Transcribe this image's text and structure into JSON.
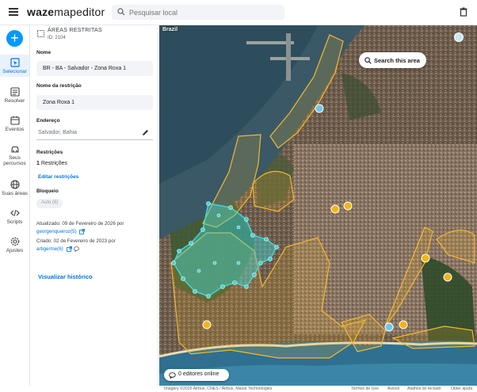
{
  "app": {
    "logo_bold": "waze",
    "logo_light": "mapeditor",
    "search_placeholder": "Pesquisar local"
  },
  "rail": {
    "items": [
      {
        "label": "Selecionar",
        "icon": "select-icon",
        "active": true
      },
      {
        "label": "Resolver",
        "icon": "resolve-icon"
      },
      {
        "label": "Eventos",
        "icon": "calendar-icon"
      },
      {
        "label": "Seus percursos",
        "icon": "car-icon"
      },
      {
        "label": "Suas áreas",
        "icon": "globe-icon"
      },
      {
        "label": "Scripts",
        "icon": "code-icon"
      },
      {
        "label": "Ajustes",
        "icon": "gear-icon"
      }
    ]
  },
  "panel": {
    "title": "ÁREAS RESTRITAS",
    "id": "ID: 2104",
    "name_label": "Nome",
    "name_value": "BR - BA - Salvador - Zona Roxa 1",
    "restriction_name_label": "Nome da restrição",
    "restriction_name_value": "Zona Roxa 1",
    "address_label": "Endereço",
    "address_value": "Salvador, Bahia",
    "restrictions_label": "Restrições",
    "restrictions_count": "1",
    "restrictions_word": "Restrições",
    "edit_restrictions": "Editar restrições",
    "lock_label": "Bloqueio",
    "lock_value": "Auto (6)",
    "updated_text": "Atualizado: 09 de Fevereiro de 2026 por",
    "updated_by": "georgenqueiroz(5)",
    "created_text": "Criado: 02 de Fevereiro de 2023 por",
    "created_by": "artigerme(6)",
    "history_link": "Visualizar histórico"
  },
  "map": {
    "country": "Brazil",
    "search_area": "Search this area",
    "editors_online": "0 editores online",
    "colors": {
      "water": "#2f6f8f",
      "area_outline": "#f5b82e",
      "selected": "#3fd6d6",
      "marker": "#f2b417"
    }
  },
  "footer": {
    "attribution": "Imagery ©2026 Airbus, CNES / Airbus, Maxar Technologies",
    "terms": "Termos de Uso",
    "notices": "Avisos",
    "shortcuts": "Atalhos do teclado",
    "help": "Obter ajuda"
  }
}
